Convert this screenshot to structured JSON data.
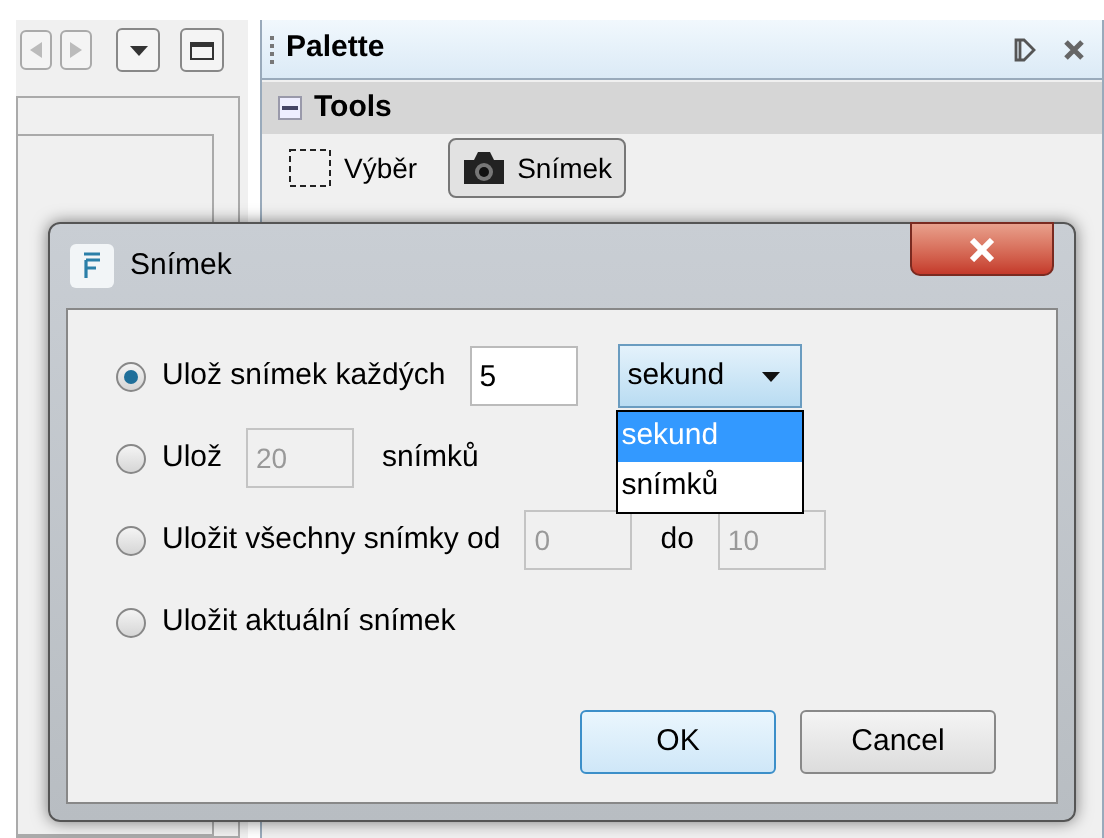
{
  "palette": {
    "title": "Palette",
    "section": {
      "title": "Tools",
      "expanded": true
    },
    "tools": [
      {
        "kind": "selection",
        "label": "Výběr",
        "selected": false
      },
      {
        "kind": "camera",
        "label": "Snímek",
        "selected": true
      }
    ]
  },
  "dialog": {
    "title": "Snímek",
    "options": [
      {
        "selected": true,
        "parts": [
          {
            "kind": "text",
            "text": "Ulož snímek každých"
          },
          {
            "kind": "field",
            "value": "5",
            "disabled": false
          },
          {
            "kind": "combo",
            "value": "sekund",
            "open": true,
            "items": [
              {
                "label": "sekund",
                "selected": true
              },
              {
                "label": "snímků",
                "selected": false
              }
            ]
          }
        ]
      },
      {
        "selected": false,
        "parts": [
          {
            "kind": "text",
            "text": "Ulož"
          },
          {
            "kind": "field",
            "value": "20",
            "disabled": true
          },
          {
            "kind": "text",
            "text": "snímků"
          }
        ]
      },
      {
        "selected": false,
        "parts": [
          {
            "kind": "text",
            "text": "Uložit všechny snímky od"
          },
          {
            "kind": "field",
            "value": "0",
            "disabled": true
          },
          {
            "kind": "text",
            "text": "do"
          },
          {
            "kind": "field",
            "value": "10",
            "disabled": true
          }
        ]
      },
      {
        "selected": false,
        "parts": [
          {
            "kind": "text",
            "text": "Uložit aktuální snímek"
          }
        ]
      }
    ],
    "buttons": [
      {
        "label": "OK",
        "default": true
      },
      {
        "label": "Cancel",
        "default": false
      }
    ]
  }
}
